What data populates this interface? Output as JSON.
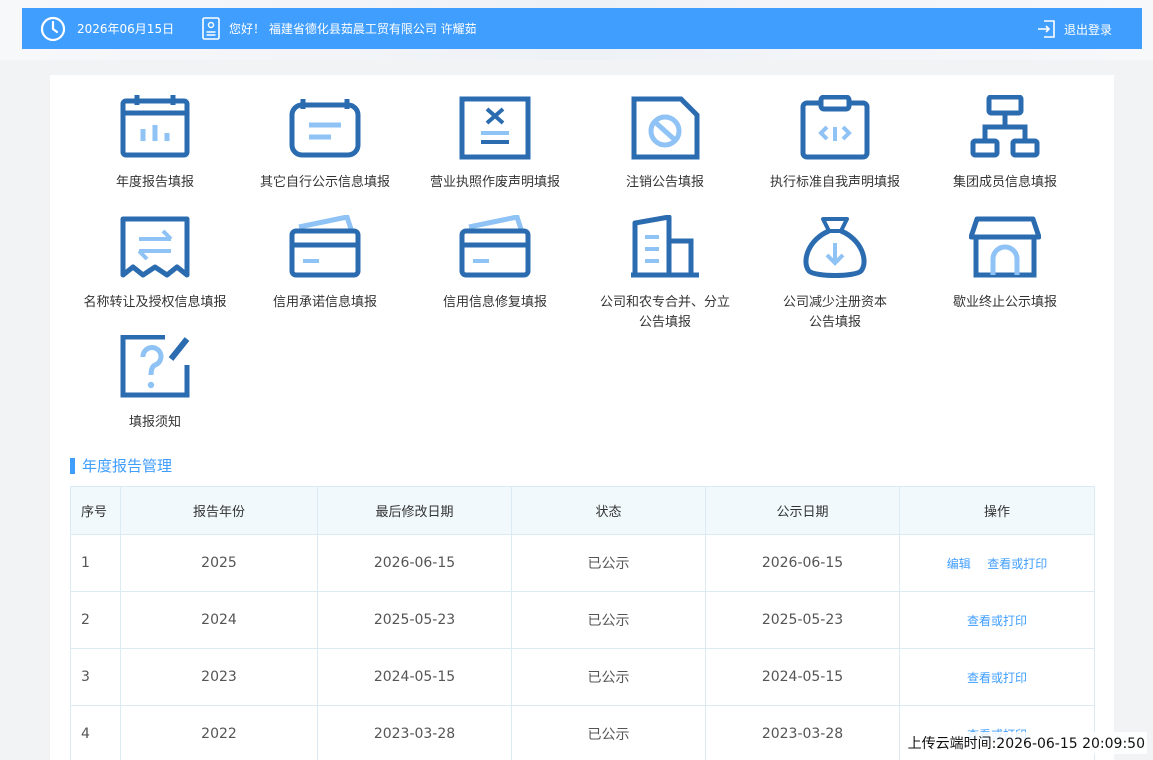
{
  "header": {
    "date": "2026年06月15日",
    "greeting": "您好！ 福建省德化县茹晨工贸有限公司 许耀茹",
    "logout_label": "退出登录"
  },
  "menu": [
    {
      "label": "年度报告填报",
      "icon": "calendar-chart-icon"
    },
    {
      "label": "其它自行公示信息填报",
      "icon": "notice-board-icon"
    },
    {
      "label": "营业执照作废声明填报",
      "icon": "license-void-icon"
    },
    {
      "label": "注销公告填报",
      "icon": "cancel-document-icon"
    },
    {
      "label": "执行标准自我声明填报",
      "icon": "clipboard-code-icon"
    },
    {
      "label": "集团成员信息填报",
      "icon": "org-chart-icon"
    },
    {
      "label": "名称转让及授权信息填报",
      "icon": "transfer-arrows-icon"
    },
    {
      "label": "信用承诺信息填报",
      "icon": "credit-card-icon"
    },
    {
      "label": "信用信息修复填报",
      "icon": "credit-card-repair-icon"
    },
    {
      "label": "公司和农专合并、分立\n公告填报",
      "icon": "buildings-icon"
    },
    {
      "label": "公司减少注册资本\n公告填报",
      "icon": "money-bag-down-icon"
    },
    {
      "label": "歇业终止公示填报",
      "icon": "shop-closed-icon"
    },
    {
      "label": "填报须知",
      "icon": "question-edit-icon"
    }
  ],
  "section": {
    "title": "年度报告管理"
  },
  "table": {
    "headers": [
      "序号",
      "报告年份",
      "最后修改日期",
      "状态",
      "公示日期",
      "操作"
    ],
    "rows": [
      {
        "idx": "1",
        "year": "2025",
        "modified": "2026-06-15",
        "status": "已公示",
        "public_date": "2026-06-15",
        "actions": [
          "编辑",
          "查看或打印"
        ]
      },
      {
        "idx": "2",
        "year": "2024",
        "modified": "2025-05-23",
        "status": "已公示",
        "public_date": "2025-05-23",
        "actions": [
          "查看或打印"
        ]
      },
      {
        "idx": "3",
        "year": "2023",
        "modified": "2024-05-15",
        "status": "已公示",
        "public_date": "2024-05-15",
        "actions": [
          "查看或打印"
        ]
      },
      {
        "idx": "4",
        "year": "2022",
        "modified": "2023-03-28",
        "status": "已公示",
        "public_date": "2023-03-28",
        "actions": [
          "查看或打印"
        ]
      }
    ]
  },
  "footer": {
    "upload_time": "上传云端时间:2026-06-15 20:09:50"
  },
  "colors": {
    "accent": "#409eff",
    "icon_dark": "#2b6cb0",
    "icon_light": "#8fc2f5"
  }
}
